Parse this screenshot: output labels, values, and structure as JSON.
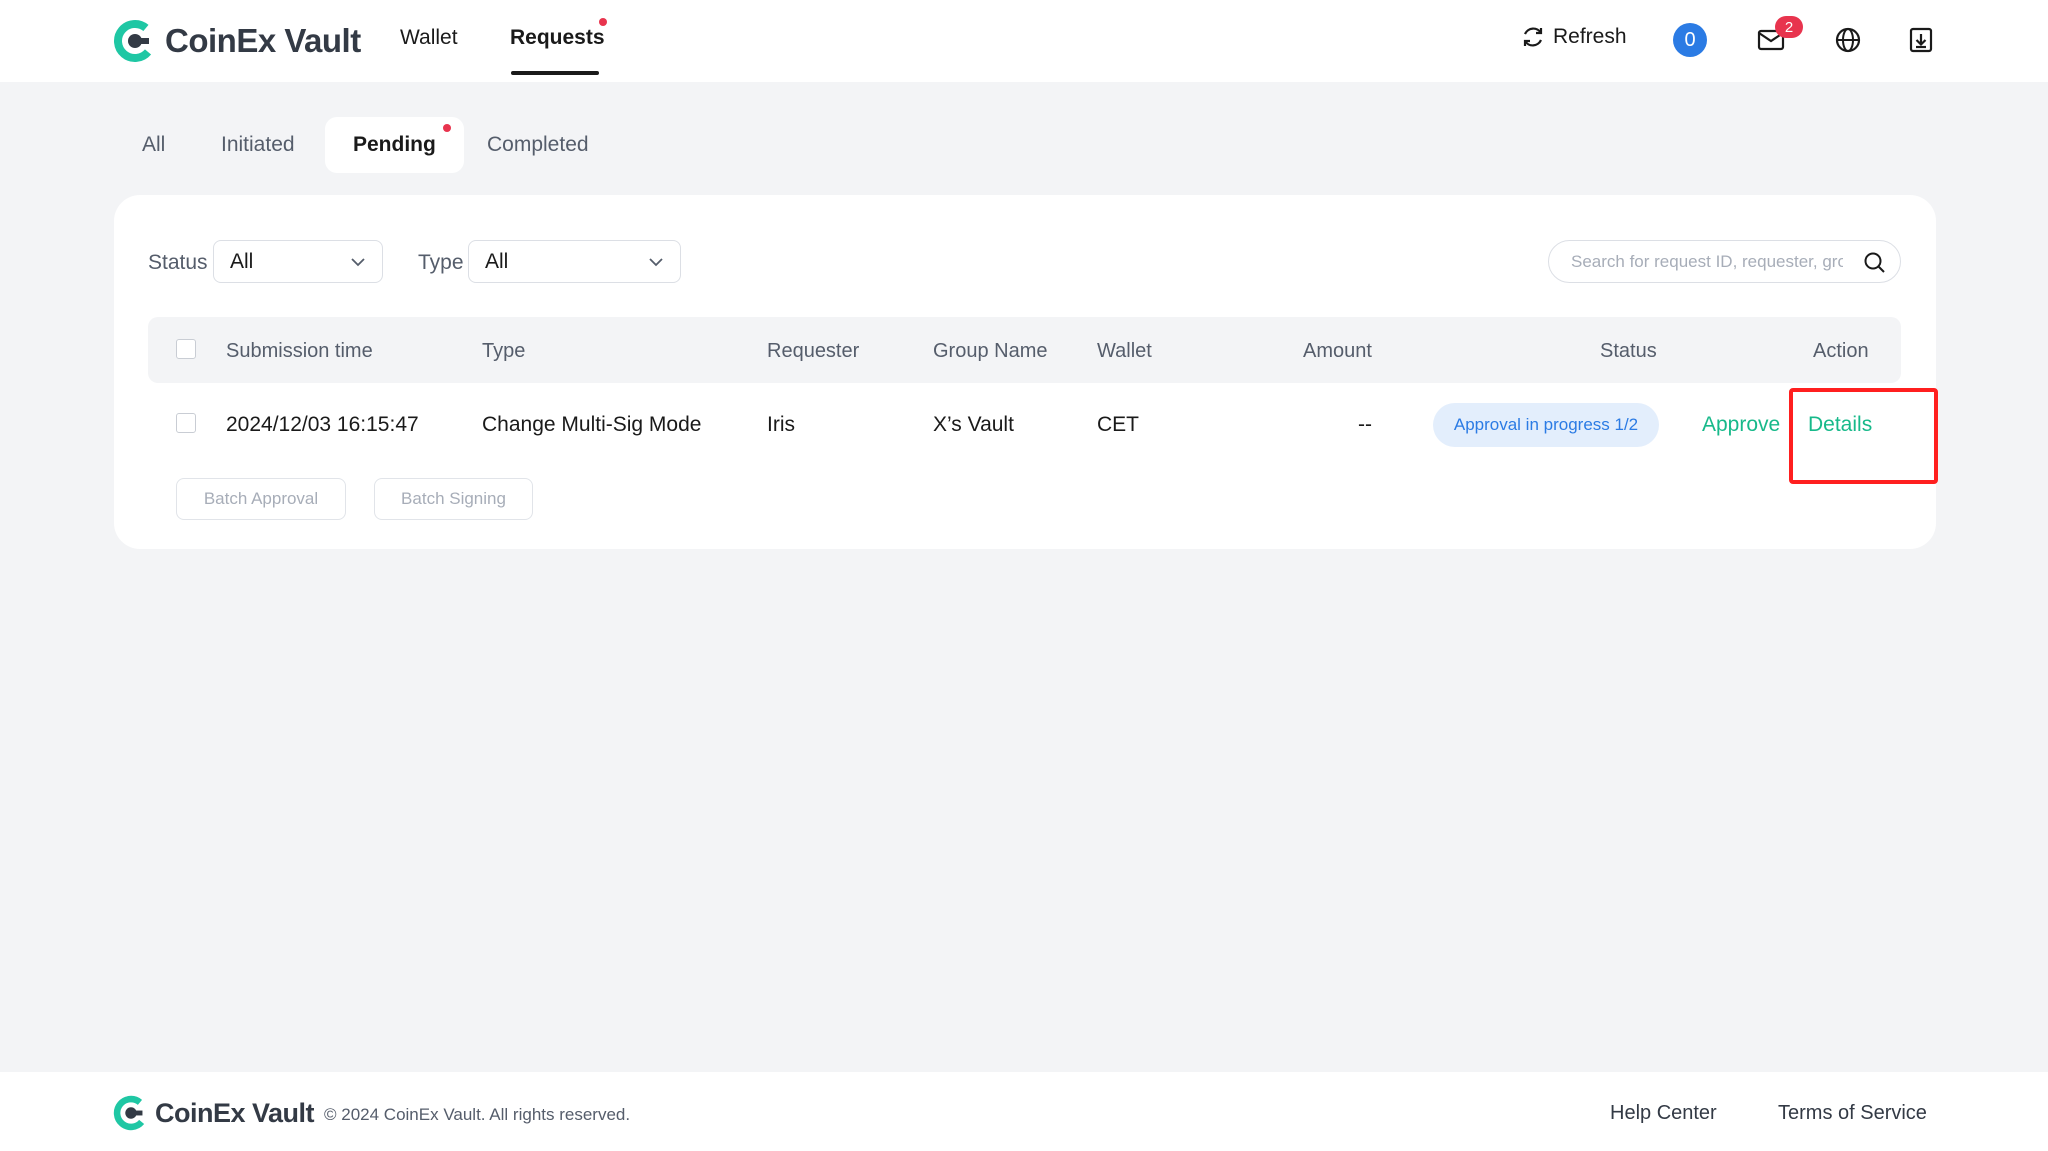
{
  "header": {
    "brand": "CoinEx Vault",
    "nav": [
      {
        "label": "Wallet"
      },
      {
        "label": "Requests"
      }
    ],
    "refresh_label": "Refresh",
    "count_badge": "0",
    "mail_badge": "2",
    "icons": [
      "refresh-icon",
      "mail-icon",
      "globe-icon",
      "download-icon"
    ],
    "accent_color": "#17b98a",
    "badge_color": "#2b7be4",
    "alert_color": "#e8344e"
  },
  "tabs": [
    {
      "label": "All"
    },
    {
      "label": "Initiated"
    },
    {
      "label": "Pending"
    },
    {
      "label": "Completed"
    }
  ],
  "filters": {
    "status_label": "Status",
    "status_value": "All",
    "type_label": "Type",
    "type_value": "All",
    "search_placeholder": "Search for request ID, requester, group"
  },
  "table": {
    "columns": [
      "Submission time",
      "Type",
      "Requester",
      "Group Name",
      "Wallet",
      "Amount",
      "Status",
      "Action"
    ],
    "rows": [
      {
        "submission_time": "2024/12/03 16:15:47",
        "type": "Change Multi-Sig Mode",
        "requester": "Iris",
        "group_name": "X’s Vault",
        "wallet": "CET",
        "amount": "--",
        "status": "Approval in progress 1/2",
        "actions": {
          "approve": "Approve",
          "details": "Details"
        }
      }
    ]
  },
  "batch": {
    "approval": "Batch Approval",
    "signing": "Batch Signing"
  },
  "footer": {
    "brand": "CoinEx Vault",
    "copyright": "© 2024 CoinEx Vault. All rights reserved.",
    "help": "Help Center",
    "terms": "Terms of Service"
  }
}
